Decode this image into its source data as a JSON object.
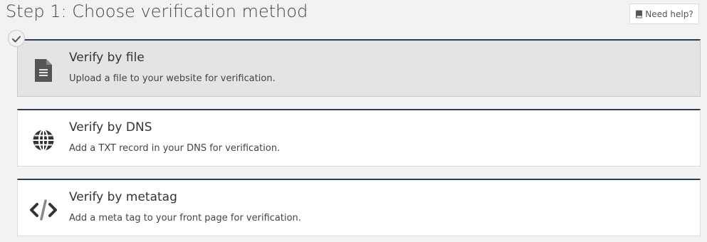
{
  "page": {
    "title": "Step 1: Choose verification method"
  },
  "help_button": {
    "label": "Need help?",
    "icon": "book-icon"
  },
  "selected_indicator": {
    "icon": "checkmark-icon"
  },
  "methods": [
    {
      "title": "Verify by file",
      "description": "Upload a file to your website for verification.",
      "icon": "file-icon",
      "selected": true
    },
    {
      "title": "Verify by DNS",
      "description": "Add a TXT record in your DNS for verification.",
      "icon": "globe-icon",
      "selected": false
    },
    {
      "title": "Verify by metatag",
      "description": "Add a meta tag to your front page for verification.",
      "icon": "code-icon",
      "selected": false
    }
  ],
  "colors": {
    "accent_border": "#2b3a55",
    "selected_background": "#e4e4e4",
    "page_background": "#f2f2f2"
  }
}
